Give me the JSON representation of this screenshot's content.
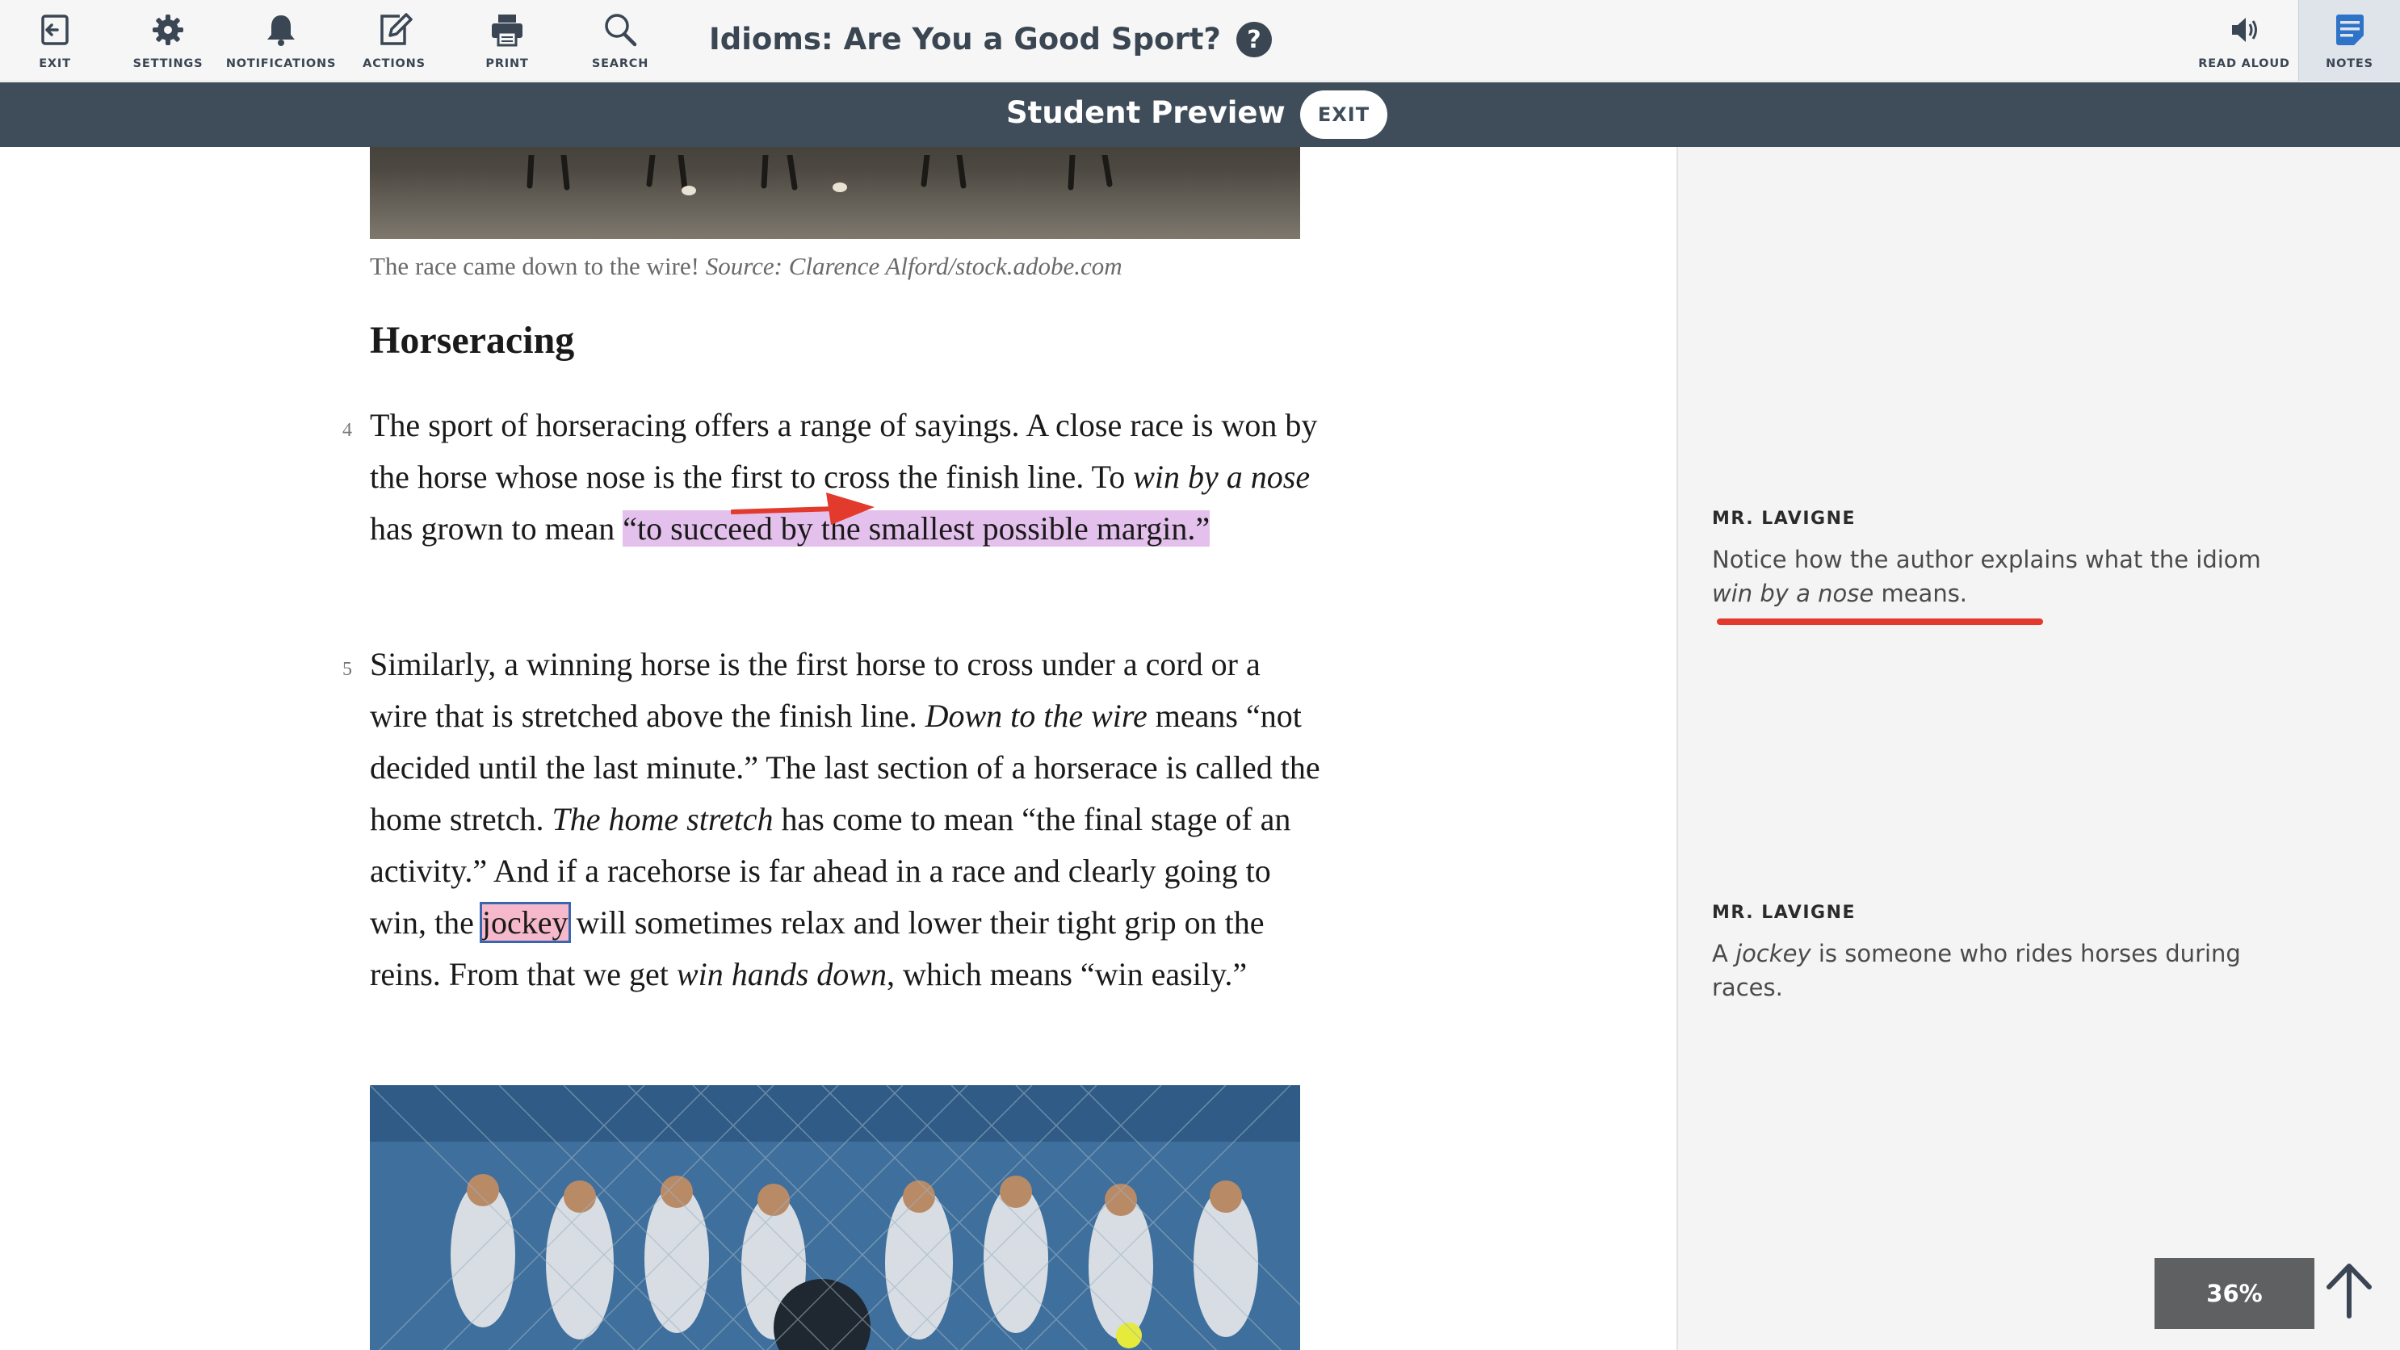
{
  "toolbar": {
    "items": [
      {
        "label": "EXIT",
        "icon": "exit-icon"
      },
      {
        "label": "SETTINGS",
        "icon": "gear-icon"
      },
      {
        "label": "NOTIFICATIONS",
        "icon": "bell-icon"
      },
      {
        "label": "ACTIONS",
        "icon": "edit-icon"
      },
      {
        "label": "PRINT",
        "icon": "printer-icon"
      },
      {
        "label": "SEARCH",
        "icon": "search-icon"
      }
    ],
    "title": "Idioms: Are You a Good Sport?",
    "help_label": "?",
    "read_aloud_label": "READ ALOUD",
    "notes_label": "NOTES"
  },
  "preview": {
    "title": "Student Preview",
    "exit_label": "EXIT"
  },
  "article": {
    "caption_text": "The race came down to the wire! ",
    "caption_source": "Source: Clarence Alford/stock.adobe.com",
    "heading": "Horseracing",
    "p4": {
      "num": "4",
      "t1": "The sport of horseracing offers a range of sayings. A close race is won by the horse whose nose is the first to cross the finish line. To ",
      "i1": "win by a nose",
      "t2": " has grown to mean ",
      "hl": "“to succeed by the smallest possible margin.”"
    },
    "p5": {
      "num": "5",
      "t1": "Similarly, a winning horse is the first horse to cross under a cord or a wire that is stretched above the finish line. ",
      "i1": "Down to the wire",
      "t2": " means “not decided until the last minute.” The last section of a horserace is called the home stretch. ",
      "i2": "The home stretch",
      "t3": " has come to mean “the final stage of an activity.” And if a racehorse is far ahead in a race and clearly going to win, the ",
      "hl": "jockey",
      "t4": " will sometimes relax and lower their tight grip on the reins. From that we get ",
      "i3": "win hands down",
      "t5": ", which means “win easily.”"
    }
  },
  "notes": [
    {
      "author": "MR. LAVIGNE",
      "t1": "Notice how the author explains what the idiom ",
      "i1": "win by a nose",
      "t2": " means."
    },
    {
      "author": "MR. LAVIGNE",
      "t1": "A ",
      "i1": "jockey",
      "t2": " is someone who rides horses during races."
    }
  ],
  "progress_label": "36%",
  "colors": {
    "toolbar_bg": "#f6f6f6",
    "banner_bg": "#3f4d5a",
    "highlight_purple": "#e4c1ec",
    "highlight_pink": "#f5b9cb",
    "annotation_red": "#e23a2c"
  }
}
